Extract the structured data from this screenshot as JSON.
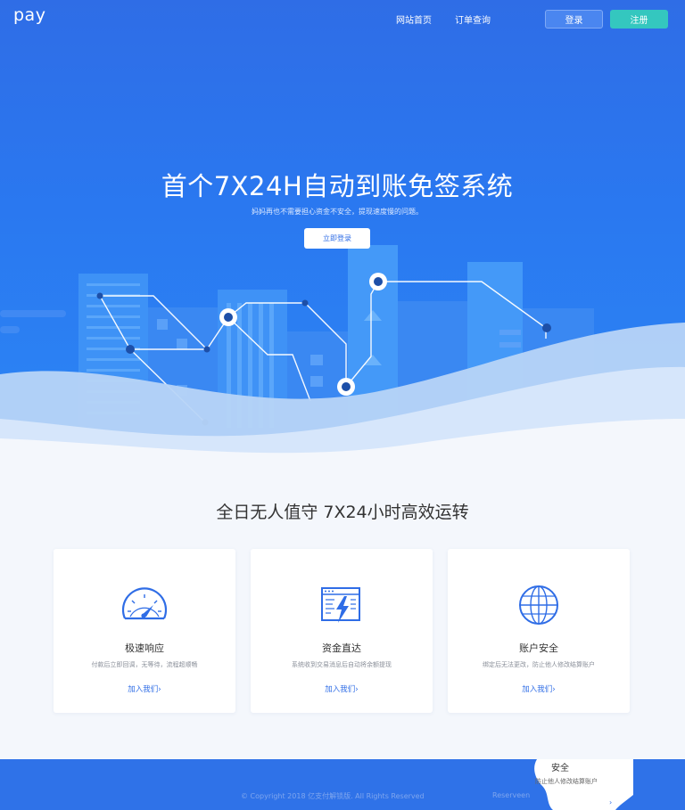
{
  "header": {
    "logo": "pay",
    "nav": [
      {
        "label": "网站首页"
      },
      {
        "label": "订单查询"
      }
    ],
    "login_label": "登录",
    "register_label": "注册"
  },
  "hero": {
    "title": "首个7X24H自动到账免签系统",
    "subtitle": "妈妈再也不需要担心资金不安全，提现速度慢的问题。",
    "cta_label": "立即登录"
  },
  "features": {
    "title": "全日无人值守  7X24小时高效运转",
    "cards": [
      {
        "icon": "speedometer-icon",
        "title": "极速响应",
        "desc": "付款后立即回调，无等待，流程超顺畅",
        "link": "加入我们"
      },
      {
        "icon": "lightning-panel-icon",
        "title": "资金直达",
        "desc": "系统收到交易消息后自动将余额提现",
        "link": "加入我们"
      },
      {
        "icon": "globe-icon",
        "title": "账户安全",
        "desc": "绑定后无法更改，防止他人修改结算账户",
        "link": "加入我们"
      }
    ]
  },
  "footer": {
    "copyright": "© Copyright 2018 亿支付解锁版. All Rights Reserved",
    "extra": "Reserveen",
    "ghost_title": "安全",
    "ghost_desc": "防止他人修改结算账户",
    "ghost_arrow": "›"
  },
  "colors": {
    "brand_blue": "#2f6de6",
    "register_teal": "#34c7bf",
    "footer_blue": "#2f72e8"
  }
}
